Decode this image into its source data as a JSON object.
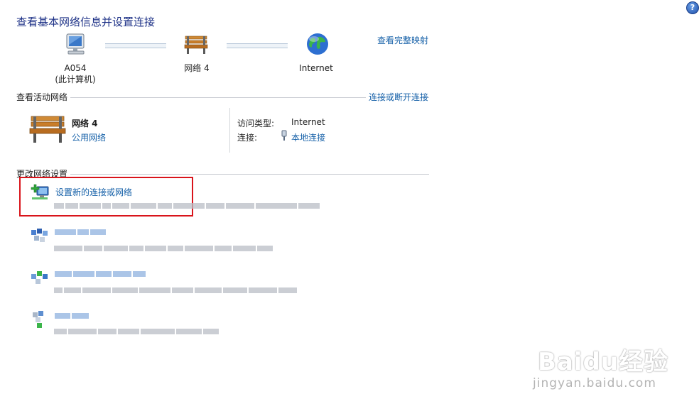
{
  "header": {
    "title": "查看基本网络信息并设置连接",
    "full_map_link": "查看完整映射",
    "help_glyph": "?"
  },
  "network_map": {
    "computer": {
      "name": "A054",
      "subtitle": "(此计算机)",
      "icon": "computer-icon"
    },
    "network": {
      "name": "网络  4",
      "icon": "bench-icon"
    },
    "internet": {
      "name": "Internet",
      "icon": "globe-icon"
    }
  },
  "active_networks": {
    "heading": "查看活动网络",
    "connect_link": "连接或断开连接",
    "network_name": "网络  4",
    "network_type": "公用网络",
    "access_type_label": "访问类型:",
    "access_type_value": "Internet",
    "connection_label": "连接:",
    "connection_value": "本地连接"
  },
  "change_settings": {
    "heading": "更改网络设置",
    "items": [
      {
        "title": "设置新的连接或网络",
        "highlighted": true,
        "icon": "new-connection-icon"
      }
    ]
  },
  "watermark": {
    "brand": "Baidu经验",
    "url": "jingyan.baidu.com"
  },
  "colors": {
    "link": "#1560a8",
    "title": "#1e3287",
    "highlight_border": "#d9141b"
  }
}
